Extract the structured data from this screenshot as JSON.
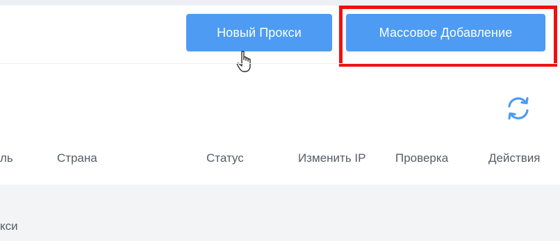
{
  "toolbar": {
    "new_proxy_label": "Новый Прокси",
    "bulk_add_label": "Массовое Добавление"
  },
  "table": {
    "columns": [
      "ль",
      "Страна",
      "Статус",
      "Изменить IP",
      "Проверка",
      "Действия"
    ],
    "empty_text": "кси"
  },
  "icons": {
    "refresh": "refresh-icon",
    "cursor": "hand-pointer-icon"
  },
  "colors": {
    "button": "#4d9bf2",
    "highlight": "#ee1111",
    "refresh": "#4d9bf2",
    "body_bg": "#f3f4f6",
    "text": "#555c66"
  }
}
